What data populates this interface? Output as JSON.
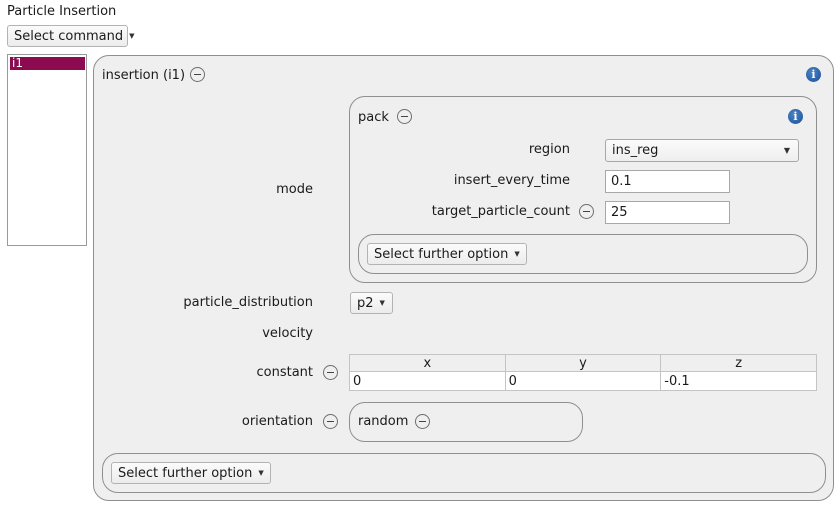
{
  "page": {
    "title": "Particle Insertion"
  },
  "toolbar": {
    "select_command": "Select command"
  },
  "list": {
    "items": [
      "i1"
    ]
  },
  "insertion": {
    "title": "insertion (i1)",
    "mode_label": "mode",
    "pack": {
      "title": "pack",
      "region_label": "region",
      "region_value": "ins_reg",
      "insert_every_time_label": "insert_every_time",
      "insert_every_time_value": "0.1",
      "target_particle_count_label": "target_particle_count",
      "target_particle_count_value": "25",
      "further_option": "Select further option"
    },
    "particle_distribution_label": "particle_distribution",
    "particle_distribution_value": "p2",
    "velocity_label": "velocity",
    "constant_label": "constant",
    "constant_table": {
      "headers": [
        "x",
        "y",
        "z"
      ],
      "values": [
        "0",
        "0",
        "-0.1"
      ]
    },
    "orientation_label": "orientation",
    "orientation_value": "random",
    "further_option": "Select further option"
  },
  "colors": {
    "selection": "#8b0a50",
    "info": "#1d4f93"
  },
  "icons": [
    "minus-circle-icon",
    "info-icon",
    "dropdown-arrow-icon"
  ]
}
